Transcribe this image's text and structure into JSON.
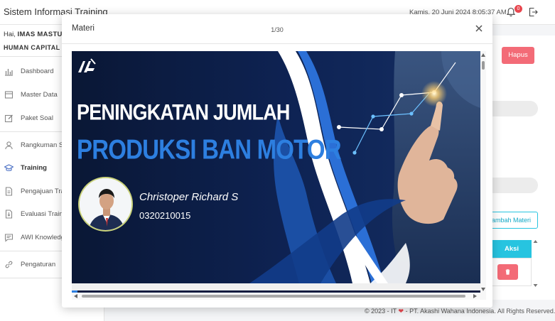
{
  "header": {
    "app_title": "Sistem Informasi Training",
    "datetime": "Kamis, 20 Juni 2024 8:05:37 AM",
    "notification_count": "0"
  },
  "user": {
    "greeting": "Hai,",
    "name": "IMAS MASTURO",
    "department": "HUMAN CAPITAL"
  },
  "sidebar": {
    "items": [
      {
        "label": "Dashboard",
        "icon": "chart-bar-icon"
      },
      {
        "label": "Master Data",
        "icon": "database-icon"
      },
      {
        "label": "Paket Soal",
        "icon": "edit-icon"
      },
      {
        "label": "Rangkuman Soal",
        "icon": "user-icon"
      },
      {
        "label": "Training",
        "icon": "graduation-cap-icon"
      },
      {
        "label": "Pengajuan Training",
        "icon": "file-icon"
      },
      {
        "label": "Evaluasi Training",
        "icon": "file-download-icon"
      },
      {
        "label": "AWI Knowledge",
        "icon": "comment-icon"
      },
      {
        "label": "Pengaturan",
        "icon": "link-icon"
      }
    ]
  },
  "page": {
    "delete_button": "Hapus",
    "add_material_button": "Tambah Materi",
    "table_header_action": "Aksi",
    "row_delete_icon": "trash-icon"
  },
  "footer": {
    "text_prefix": "© 2023 - IT",
    "text_suffix": "- PT. Akashi Wahana Indonesia. All Rights Reserved."
  },
  "modal": {
    "title": "Materi",
    "page_counter": "1/30",
    "slide": {
      "headline_line1": "PENINGKATAN JUMLAH",
      "headline_line2": "PRODUKSI BAN MOTOR",
      "presenter_name": "Christoper Richard S",
      "presenter_id": "0320210015"
    }
  },
  "colors": {
    "accent": "#27c4e0",
    "danger": "#f36b77",
    "slide_background": "#0c1b3e",
    "slide_headline_blue": "#2d7fe0"
  }
}
